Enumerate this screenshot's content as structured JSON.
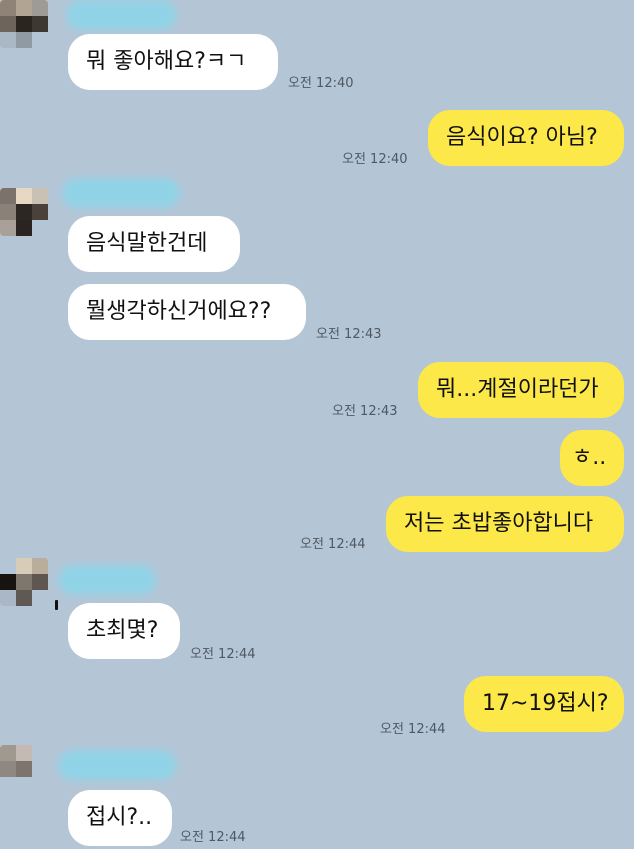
{
  "theme": {
    "background": "#b4c5d6",
    "incoming_bubble": "#ffffff",
    "outgoing_bubble": "#fde84a",
    "name_blur": "#8ad6ea"
  },
  "messages": [
    {
      "side": "in",
      "text": "뭐 좋아해요?ㅋㄱ",
      "time": "오전 12:40"
    },
    {
      "side": "out",
      "text": "음식이요? 아님?",
      "time": "오전 12:40"
    },
    {
      "side": "in",
      "text": "음식말한건데"
    },
    {
      "side": "in",
      "text": "뭘생각하신거에요??",
      "time": "오전 12:43"
    },
    {
      "side": "out",
      "text": "뭐...계절이라던가",
      "time": "오전 12:43"
    },
    {
      "side": "out",
      "text": "ㅎ.."
    },
    {
      "side": "out",
      "text": "저는 초밥좋아합니다",
      "time": "오전 12:44"
    },
    {
      "side": "in",
      "text": "초최몇?",
      "time": "오전 12:44"
    },
    {
      "side": "out",
      "text": "17~19접시?",
      "time": "오전 12:44"
    },
    {
      "side": "in",
      "text": "접시?..",
      "time": "오전 12:44"
    }
  ]
}
